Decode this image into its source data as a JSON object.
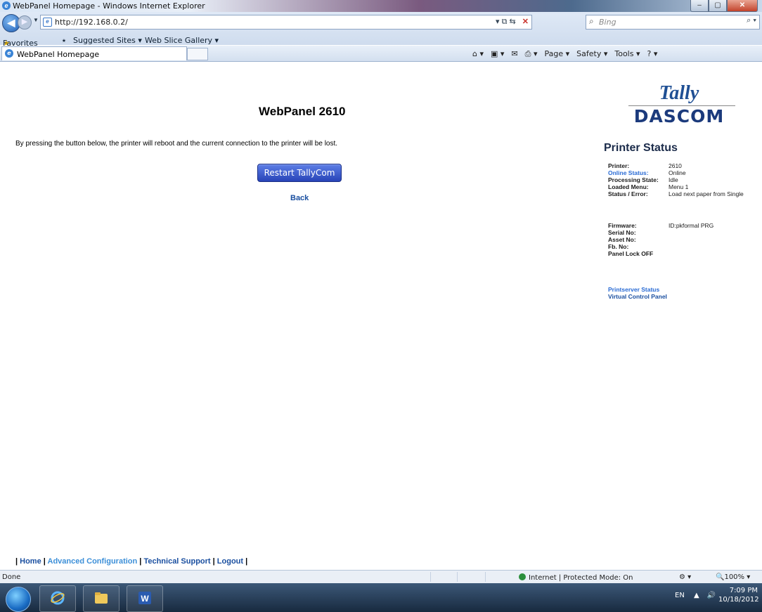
{
  "browser": {
    "window_title": "WebPanel Homepage - Windows Internet Explorer",
    "url": "http://192.168.0.2/",
    "search_placeholder": "Bing",
    "favorites_label": "Favorites",
    "favorites_links": [
      "Suggested Sites ▾",
      "Web Slice Gallery ▾"
    ],
    "tab_title": "WebPanel Homepage",
    "command_bar": [
      "Page ▾",
      "Safety ▾",
      "Tools ▾"
    ],
    "status_text": "Done",
    "zone_text": "Internet | Protected Mode: On",
    "zoom": "100%"
  },
  "page": {
    "title": "WebPanel 2610",
    "info_text": "By pressing the button below, the printer will reboot and the current connection to the printer will be lost.",
    "restart_label": "Restart TallyCom",
    "back_label": "Back"
  },
  "logo": {
    "top": "Tally",
    "bottom": "DASCOM"
  },
  "printer_status": {
    "title": "Printer Status",
    "rows": [
      {
        "label": "Printer:",
        "value": "2610"
      },
      {
        "label": "Online Status:",
        "value": "Online"
      },
      {
        "label": "Processing State:",
        "value": "Idle"
      },
      {
        "label": "Loaded Menu:",
        "value": "Menu 1"
      },
      {
        "label": "Status / Error:",
        "value": "Load next paper from Single"
      }
    ],
    "rows2": [
      {
        "label": "Firmware:",
        "value": "ID:pkformal PRG"
      },
      {
        "label": "Serial No:",
        "value": ""
      },
      {
        "label": "Asset No:",
        "value": ""
      },
      {
        "label": "Fb. No:",
        "value": ""
      },
      {
        "label": "Panel Lock OFF",
        "value": ""
      }
    ],
    "links": [
      "Printserver Status",
      "Virtual Control Panel"
    ]
  },
  "footer": {
    "sep": "|",
    "home": "Home",
    "advanced": "Advanced Configuration",
    "support": "Technical Support",
    "logout": "Logout"
  },
  "taskbar": {
    "lang": "EN",
    "time": "7:09 PM",
    "date": "10/18/2012"
  }
}
